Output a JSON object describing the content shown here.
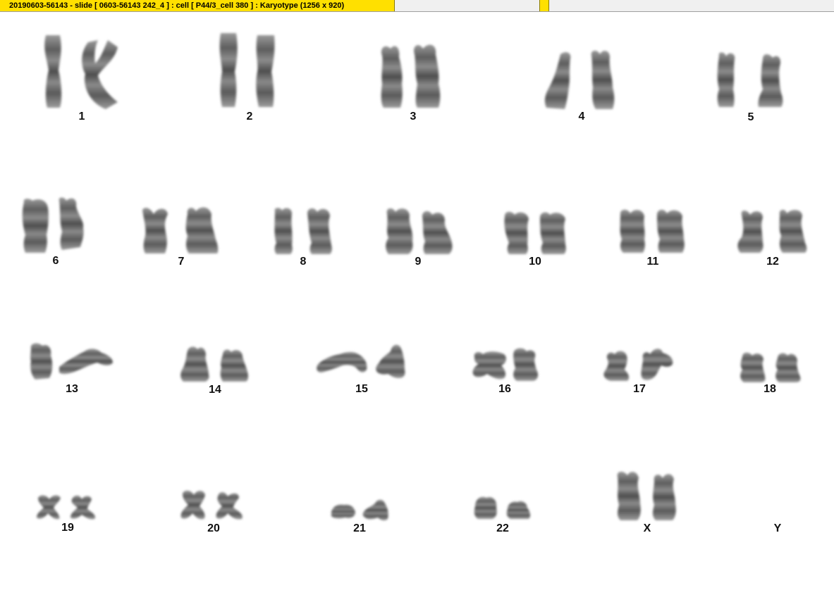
{
  "window": {
    "title": "20190603-56143 - slide [ 0603-56143 242_4 ] : cell [ P44/3_cell 380 ] : Karyotype  (1256 x 920)"
  },
  "karyotype": {
    "labels": {
      "c1": "1",
      "c2": "2",
      "c3": "3",
      "c4": "4",
      "c5": "5",
      "c6": "6",
      "c7": "7",
      "c8": "8",
      "c9": "9",
      "c10": "10",
      "c11": "11",
      "c12": "12",
      "c13": "13",
      "c14": "14",
      "c15": "15",
      "c16": "16",
      "c17": "17",
      "c18": "18",
      "c19": "19",
      "c20": "20",
      "c21": "21",
      "c22": "22",
      "cX": "X",
      "cY": "Y"
    }
  },
  "colors": {
    "title_tab_bg": "#ffe000",
    "chromosome": "#6e6e6e"
  }
}
